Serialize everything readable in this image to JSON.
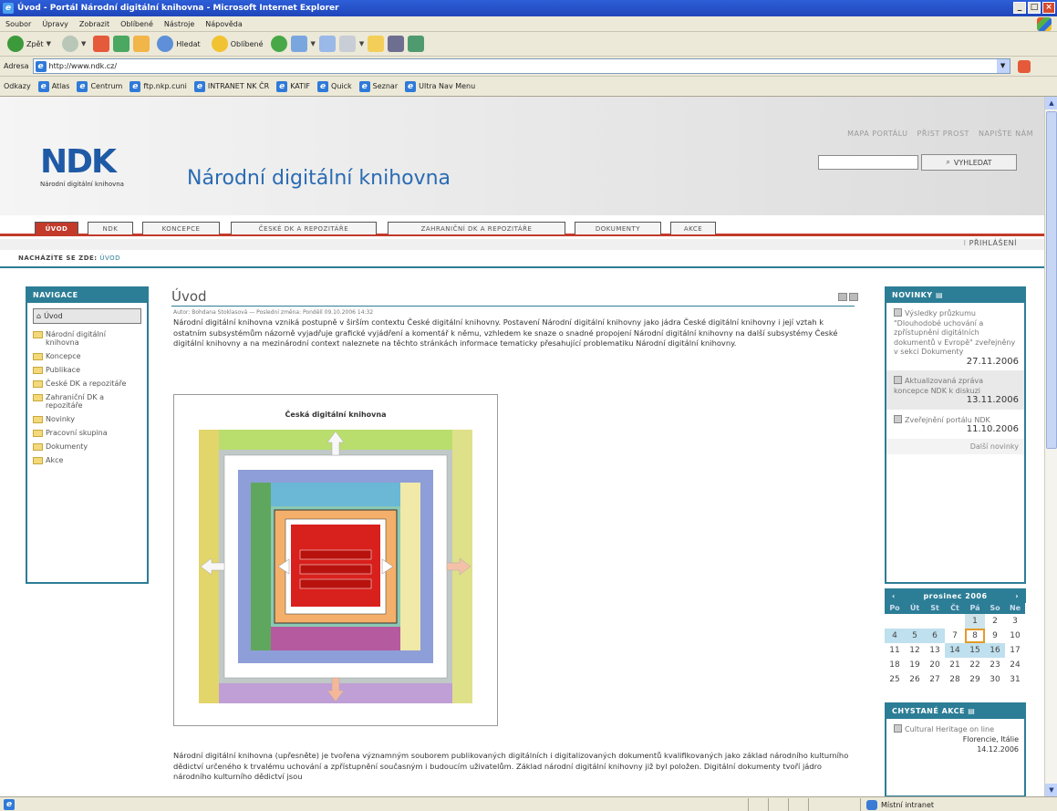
{
  "window": {
    "title": "Úvod - Portál Národní digitální knihovna - Microsoft Internet Explorer"
  },
  "menu": [
    "Soubor",
    "Úpravy",
    "Zobrazit",
    "Oblíbené",
    "Nástroje",
    "Nápověda"
  ],
  "toolbar": {
    "back": "Zpět",
    "search": "Hledat",
    "favorites": "Oblíbené"
  },
  "address": {
    "label": "Adresa",
    "url": "http://www.ndk.cz/"
  },
  "links": {
    "label": "Odkazy",
    "items": [
      "Atlas",
      "Centrum",
      "ftp.nkp.cuni",
      "INTRANET NK ČR",
      "KATIF",
      "Quick",
      "Seznar",
      "Ultra Nav Menu"
    ]
  },
  "status": {
    "zone": "Místní intranet"
  },
  "site": {
    "util_links": [
      "MAPA PORTÁLU",
      "PŘIST PROST",
      "NAPIŠTE NÁM"
    ],
    "search_button": "VYHLEDAT",
    "logo_text": "NDK",
    "logo_subtitle": "Národní digitální knihovna",
    "title": "Národní digitální knihovna",
    "tabs": [
      "ÚVOD",
      "NDK",
      "KONCEPCE",
      "ČESKÉ DK A REPOZITÁŘE",
      "ZAHRANIČNÍ DK A REPOZITÁŘE",
      "DOKUMENTY",
      "AKCE"
    ],
    "login": "PŘIHLÁŠENÍ",
    "breadcrumb_label": "NACHÁZÍTE SE ZDE:",
    "breadcrumb_current": "ÚVOD"
  },
  "navigation": {
    "header": "NAVIGACE",
    "items": [
      "Úvod",
      "Národní digitální knihovna",
      "Koncepce",
      "Publikace",
      "České DK a repozitáře",
      "Zahraniční DK a repozitáře",
      "Novinky",
      "Pracovní skupina",
      "Dokumenty",
      "Akce"
    ]
  },
  "article": {
    "title": "Úvod",
    "meta": "Autor: Bohdana Stoklasová — Poslední změna: Pondělí 09.10.2006 14:32",
    "intro": "Národní digitální knihovna vzniká postupně v širším contextu České digitální knihovny. Postavení Národní digitální knihovny jako jádra České digitální knihovny i její vztah k ostatním subsystémům názorně vyjadřuje grafické vyjádření a komentář k němu, vzhledem ke snaze o snadné propojení Národní digitální knihovny na další subsystémy České digitální knihovny a na mezinárodní context naleznete na těchto stránkách informace tematicky přesahující problematiku Národní digitální knihovny.",
    "figure_title": "Česká digitální knihovna",
    "outro": "Národní digitální knihovna (upřesněte) je tvořena významným souborem publikovaných digitálních i digitalizovaných dokumentů kvalifikovaných jako základ národního kulturního dědictví určeného k trvalému uchování a zpřístupnění současným i budoucím uživatelům. Základ národní digitální knihovny již byl položen. Digitální dokumenty tvoří jádro národního kulturního dědictví jsou"
  },
  "news": {
    "header": "NOVINKY",
    "items": [
      {
        "text": "Výsledky průzkumu \"Dlouhodobé uchování a zpřístupnění digitálních dokumentů v Evropě\" zveřejněny v sekci Dokumenty",
        "date": "27.11.2006"
      },
      {
        "text": "Aktualizovaná zpráva koncepce NDK k diskuzi",
        "date": "13.11.2006"
      },
      {
        "text": "Zveřejnění portálu NDK",
        "date": "11.10.2006"
      }
    ],
    "more": "Další novinky"
  },
  "calendar": {
    "title": "prosinec 2006",
    "prev": "‹",
    "next": "›",
    "day_headers": [
      "Po",
      "Út",
      "St",
      "Čt",
      "Pá",
      "So",
      "Ne"
    ],
    "cells": [
      "",
      "",
      "",
      "",
      "1",
      "2",
      "3",
      "4",
      "5",
      "6",
      "7",
      "8",
      "9",
      "10",
      "11",
      "12",
      "13",
      "14",
      "15",
      "16",
      "17",
      "18",
      "19",
      "20",
      "21",
      "22",
      "23",
      "24",
      "25",
      "26",
      "27",
      "28",
      "29",
      "30",
      "31"
    ]
  },
  "events": {
    "header": "CHYSTANÉ AKCE",
    "items": [
      {
        "name": "Cultural Heritage on line",
        "place": "Florencie, Itálie",
        "date": "14.12.2006"
      }
    ]
  }
}
